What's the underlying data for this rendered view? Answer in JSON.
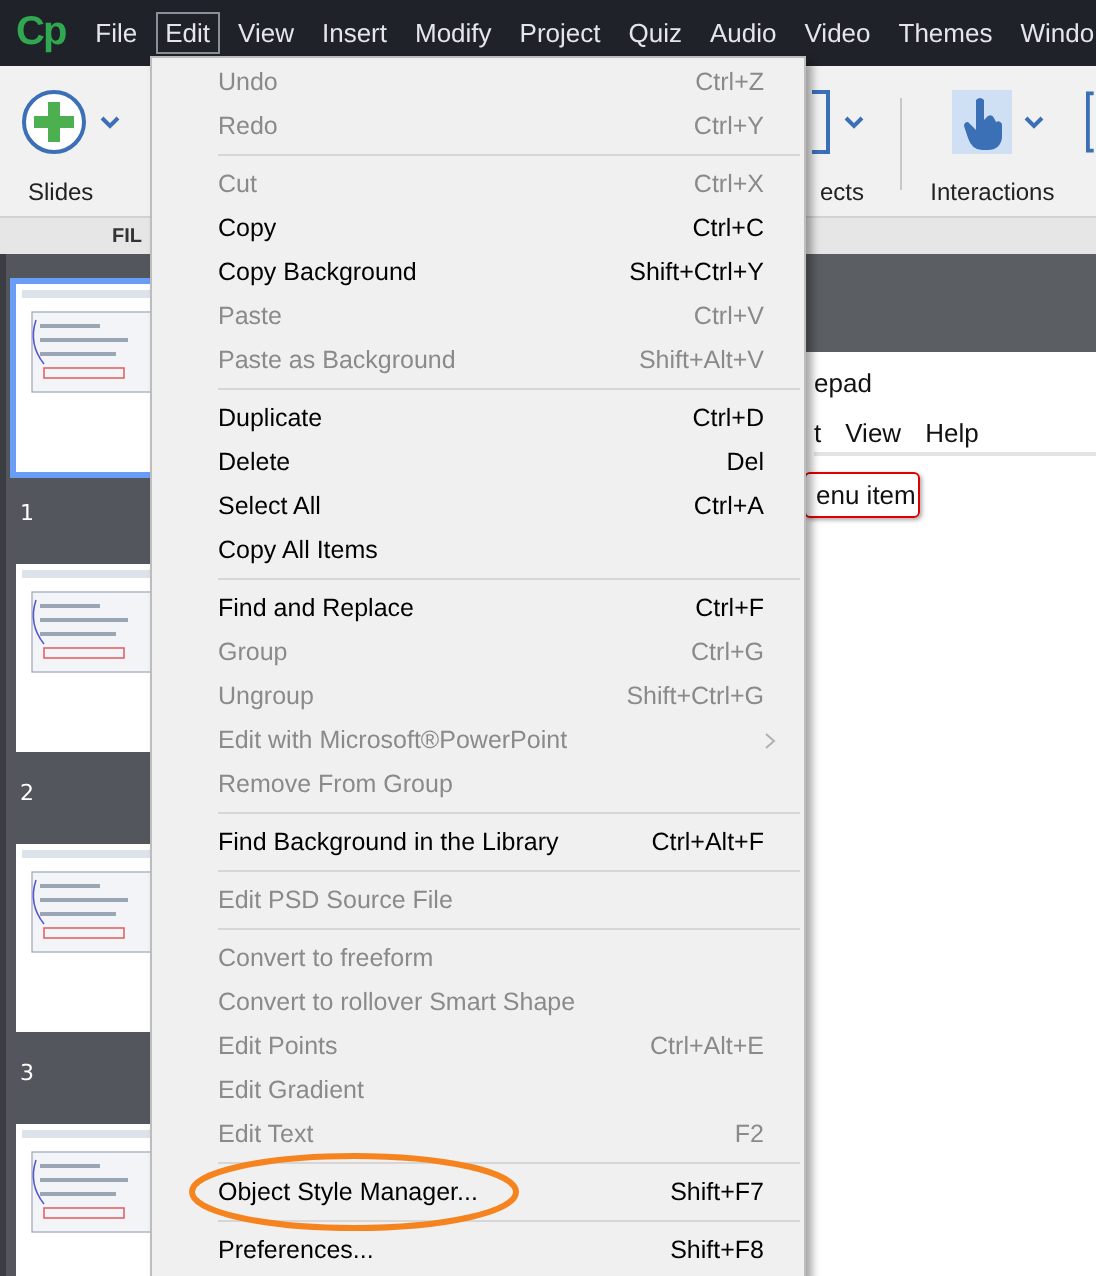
{
  "app": {
    "logo": "Cp"
  },
  "menubar": [
    {
      "label": "File",
      "selected": false
    },
    {
      "label": "Edit",
      "selected": true
    },
    {
      "label": "View",
      "selected": false
    },
    {
      "label": "Insert",
      "selected": false
    },
    {
      "label": "Modify",
      "selected": false
    },
    {
      "label": "Project",
      "selected": false
    },
    {
      "label": "Quiz",
      "selected": false
    },
    {
      "label": "Audio",
      "selected": false
    },
    {
      "label": "Video",
      "selected": false
    },
    {
      "label": "Themes",
      "selected": false
    },
    {
      "label": "Windo",
      "selected": false
    }
  ],
  "toolbar": [
    {
      "kind": "slides",
      "label": "Slides"
    },
    {
      "kind": "objects",
      "label": "ects"
    },
    {
      "kind": "interactions",
      "label": "Interactions"
    }
  ],
  "ribbon_tab": "FIL",
  "filmstrip": [
    {
      "number": "1",
      "selected": true
    },
    {
      "number": "2",
      "selected": false
    },
    {
      "number": "3",
      "selected": false
    },
    {
      "selected": false
    }
  ],
  "slide": {
    "title": "epad",
    "menu": [
      "t",
      "View",
      "Help"
    ],
    "callout": "enu item"
  },
  "edit_menu": [
    [
      {
        "label": "Undo",
        "shortcut": "Ctrl+Z",
        "disabled": true
      },
      {
        "label": "Redo",
        "shortcut": "Ctrl+Y",
        "disabled": true
      }
    ],
    [
      {
        "label": "Cut",
        "shortcut": "Ctrl+X",
        "disabled": true
      },
      {
        "label": "Copy",
        "shortcut": "Ctrl+C",
        "disabled": false
      },
      {
        "label": "Copy Background",
        "shortcut": "Shift+Ctrl+Y",
        "disabled": false
      },
      {
        "label": "Paste",
        "shortcut": "Ctrl+V",
        "disabled": true
      },
      {
        "label": "Paste as Background",
        "shortcut": "Shift+Alt+V",
        "disabled": true
      }
    ],
    [
      {
        "label": "Duplicate",
        "shortcut": "Ctrl+D",
        "disabled": false
      },
      {
        "label": "Delete",
        "shortcut": "Del",
        "disabled": false
      },
      {
        "label": "Select All",
        "shortcut": "Ctrl+A",
        "disabled": false
      },
      {
        "label": "Copy All Items",
        "disabled": false
      }
    ],
    [
      {
        "label": "Find and Replace",
        "shortcut": "Ctrl+F",
        "disabled": false
      },
      {
        "label": "Group",
        "shortcut": "Ctrl+G",
        "disabled": true
      },
      {
        "label": "Ungroup",
        "shortcut": "Shift+Ctrl+G",
        "disabled": true
      },
      {
        "label": "Edit with Microsoft®PowerPoint",
        "submenu": true,
        "disabled": true
      },
      {
        "label": "Remove From Group",
        "disabled": true
      }
    ],
    [
      {
        "label": "Find Background in the Library",
        "shortcut": "Ctrl+Alt+F",
        "disabled": false
      }
    ],
    [
      {
        "label": "Edit PSD Source File",
        "disabled": true
      }
    ],
    [
      {
        "label": "Convert to freeform",
        "disabled": true
      },
      {
        "label": "Convert to rollover Smart Shape",
        "disabled": true
      },
      {
        "label": "Edit Points",
        "shortcut": "Ctrl+Alt+E",
        "disabled": true
      },
      {
        "label": "Edit Gradient",
        "disabled": true
      },
      {
        "label": "Edit Text",
        "shortcut": "F2",
        "disabled": true
      }
    ],
    [
      {
        "label": "Object Style Manager...",
        "shortcut": "Shift+F7",
        "disabled": false,
        "highlighted": true
      }
    ],
    [
      {
        "label": "Preferences...",
        "shortcut": "Shift+F8",
        "disabled": false
      }
    ]
  ]
}
